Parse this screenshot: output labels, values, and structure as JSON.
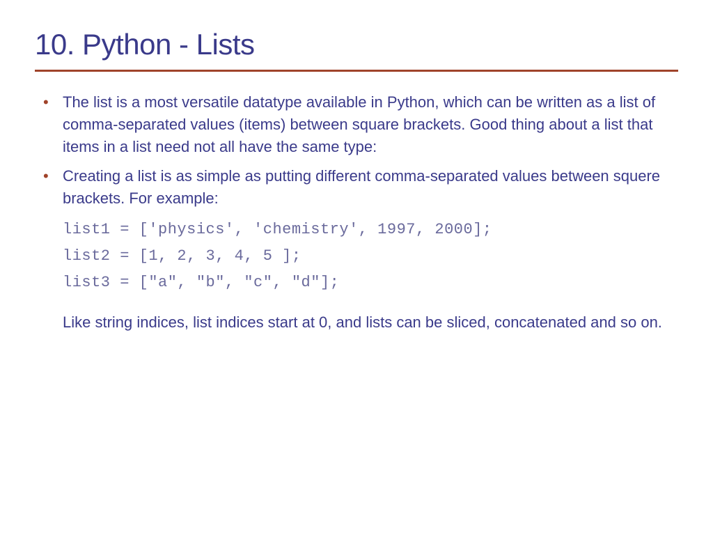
{
  "slide": {
    "title": "10. Python - Lists",
    "bullets": [
      "The list is a most versatile datatype available in Python, which can be written as a list of comma-separated values (items) between square brackets. Good thing about a list that items in a list need not all have the same type:",
      "Creating a list is as simple as putting different comma-separated values between squere brackets. For example:"
    ],
    "code": [
      "list1 = ['physics', 'chemistry', 1997, 2000];",
      "list2 = [1, 2, 3, 4, 5 ];",
      "list3 = [\"a\", \"b\", \"c\", \"d\"];"
    ],
    "footer": "Like string indices, list indices start at 0, and lists can be sliced, concatenated and so on."
  }
}
